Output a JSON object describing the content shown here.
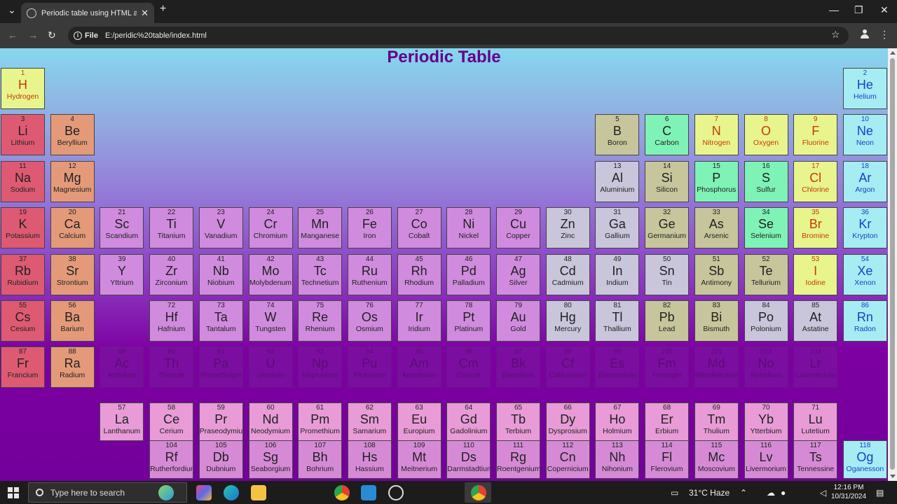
{
  "browser": {
    "tab_title": "Periodic table using HTML and",
    "tab_close": "✕",
    "new_tab": "+",
    "address_chip": "File",
    "url": "E:/peridic%20table/index.html"
  },
  "page": {
    "title": "Periodic Table"
  },
  "colors": {
    "alkali": "#de5a73",
    "alkaline": "#e49a79",
    "transition": "#d08bde",
    "post_transition": "#c9c5db",
    "metalloid": "#c7c59b",
    "nonmetal": "#7ff2b6",
    "noble": "#a6ecf3",
    "halogen": "#e8f58c",
    "lanthanide": "#e89bd7",
    "actinide": "#d68ad6",
    "period7_faded": "#7a2aa0"
  },
  "elements": [
    {
      "n": "1",
      "s": "H",
      "name": "Hydrogen",
      "cat": "halogen",
      "col": 1,
      "row": 1
    },
    {
      "n": "2",
      "s": "He",
      "name": "Helium",
      "cat": "noble",
      "col": 18,
      "row": 1
    },
    {
      "n": "3",
      "s": "Li",
      "name": "Lithium",
      "cat": "alkali",
      "col": 1,
      "row": 2
    },
    {
      "n": "4",
      "s": "Be",
      "name": "Beryllium",
      "cat": "alkaline",
      "col": 2,
      "row": 2
    },
    {
      "n": "5",
      "s": "B",
      "name": "Boron",
      "cat": "metalloid",
      "col": 13,
      "row": 2
    },
    {
      "n": "6",
      "s": "C",
      "name": "Carbon",
      "cat": "nonmetal",
      "col": 14,
      "row": 2
    },
    {
      "n": "7",
      "s": "N",
      "name": "Nitrogen",
      "cat": "halogen",
      "col": 15,
      "row": 2
    },
    {
      "n": "8",
      "s": "O",
      "name": "Oxygen",
      "cat": "halogen",
      "col": 16,
      "row": 2
    },
    {
      "n": "9",
      "s": "F",
      "name": "Fluorine",
      "cat": "halogen",
      "col": 17,
      "row": 2
    },
    {
      "n": "10",
      "s": "Ne",
      "name": "Neon",
      "cat": "noble",
      "col": 18,
      "row": 2
    },
    {
      "n": "11",
      "s": "Na",
      "name": "Sodium",
      "cat": "alkali",
      "col": 1,
      "row": 3
    },
    {
      "n": "12",
      "s": "Mg",
      "name": "Magnesium",
      "cat": "alkaline",
      "col": 2,
      "row": 3
    },
    {
      "n": "13",
      "s": "Al",
      "name": "Aluminium",
      "cat": "post_transition",
      "col": 13,
      "row": 3
    },
    {
      "n": "14",
      "s": "Si",
      "name": "Silicon",
      "cat": "metalloid",
      "col": 14,
      "row": 3
    },
    {
      "n": "15",
      "s": "P",
      "name": "Phosphorus",
      "cat": "nonmetal",
      "col": 15,
      "row": 3
    },
    {
      "n": "16",
      "s": "S",
      "name": "Sulfur",
      "cat": "nonmetal",
      "col": 16,
      "row": 3
    },
    {
      "n": "17",
      "s": "Cl",
      "name": "Chlorine",
      "cat": "halogen",
      "col": 17,
      "row": 3
    },
    {
      "n": "18",
      "s": "Ar",
      "name": "Argon",
      "cat": "noble",
      "col": 18,
      "row": 3
    },
    {
      "n": "19",
      "s": "K",
      "name": "Potassium",
      "cat": "alkali",
      "col": 1,
      "row": 4
    },
    {
      "n": "20",
      "s": "Ca",
      "name": "Calcium",
      "cat": "alkaline",
      "col": 2,
      "row": 4
    },
    {
      "n": "21",
      "s": "Sc",
      "name": "Scandium",
      "cat": "transition",
      "col": 3,
      "row": 4
    },
    {
      "n": "22",
      "s": "Ti",
      "name": "Titanium",
      "cat": "transition",
      "col": 4,
      "row": 4
    },
    {
      "n": "23",
      "s": "V",
      "name": "Vanadium",
      "cat": "transition",
      "col": 5,
      "row": 4
    },
    {
      "n": "24",
      "s": "Cr",
      "name": "Chromium",
      "cat": "transition",
      "col": 6,
      "row": 4
    },
    {
      "n": "25",
      "s": "Mn",
      "name": "Manganese",
      "cat": "transition",
      "col": 7,
      "row": 4
    },
    {
      "n": "26",
      "s": "Fe",
      "name": "Iron",
      "cat": "transition",
      "col": 8,
      "row": 4
    },
    {
      "n": "27",
      "s": "Co",
      "name": "Cobalt",
      "cat": "transition",
      "col": 9,
      "row": 4
    },
    {
      "n": "28",
      "s": "Ni",
      "name": "Nickel",
      "cat": "transition",
      "col": 10,
      "row": 4
    },
    {
      "n": "29",
      "s": "Cu",
      "name": "Copper",
      "cat": "transition",
      "col": 11,
      "row": 4
    },
    {
      "n": "30",
      "s": "Zn",
      "name": "Zinc",
      "cat": "post_transition",
      "col": 12,
      "row": 4
    },
    {
      "n": "31",
      "s": "Ga",
      "name": "Gallium",
      "cat": "post_transition",
      "col": 13,
      "row": 4
    },
    {
      "n": "32",
      "s": "Ge",
      "name": "Germanium",
      "cat": "metalloid",
      "col": 14,
      "row": 4
    },
    {
      "n": "33",
      "s": "As",
      "name": "Arsenic",
      "cat": "metalloid",
      "col": 15,
      "row": 4
    },
    {
      "n": "34",
      "s": "Se",
      "name": "Selenium",
      "cat": "nonmetal",
      "col": 16,
      "row": 4
    },
    {
      "n": "35",
      "s": "Br",
      "name": "Bromine",
      "cat": "halogen",
      "col": 17,
      "row": 4
    },
    {
      "n": "36",
      "s": "Kr",
      "name": "Krypton",
      "cat": "noble",
      "col": 18,
      "row": 4
    },
    {
      "n": "37",
      "s": "Rb",
      "name": "Rubidium",
      "cat": "alkali",
      "col": 1,
      "row": 5
    },
    {
      "n": "38",
      "s": "Sr",
      "name": "Strontium",
      "cat": "alkaline",
      "col": 2,
      "row": 5
    },
    {
      "n": "39",
      "s": "Y",
      "name": "Yttrium",
      "cat": "transition",
      "col": 3,
      "row": 5
    },
    {
      "n": "40",
      "s": "Zr",
      "name": "Zirconium",
      "cat": "transition",
      "col": 4,
      "row": 5
    },
    {
      "n": "41",
      "s": "Nb",
      "name": "Niobium",
      "cat": "transition",
      "col": 5,
      "row": 5
    },
    {
      "n": "42",
      "s": "Mo",
      "name": "Molybdenum",
      "cat": "transition",
      "col": 6,
      "row": 5
    },
    {
      "n": "43",
      "s": "Tc",
      "name": "Technetium",
      "cat": "transition",
      "col": 7,
      "row": 5
    },
    {
      "n": "44",
      "s": "Ru",
      "name": "Ruthenium",
      "cat": "transition",
      "col": 8,
      "row": 5
    },
    {
      "n": "45",
      "s": "Rh",
      "name": "Rhodium",
      "cat": "transition",
      "col": 9,
      "row": 5
    },
    {
      "n": "46",
      "s": "Pd",
      "name": "Palladium",
      "cat": "transition",
      "col": 10,
      "row": 5
    },
    {
      "n": "47",
      "s": "Ag",
      "name": "Silver",
      "cat": "transition",
      "col": 11,
      "row": 5
    },
    {
      "n": "48",
      "s": "Cd",
      "name": "Cadmium",
      "cat": "post_transition",
      "col": 12,
      "row": 5
    },
    {
      "n": "49",
      "s": "In",
      "name": "Indium",
      "cat": "post_transition",
      "col": 13,
      "row": 5
    },
    {
      "n": "50",
      "s": "Sn",
      "name": "Tin",
      "cat": "post_transition",
      "col": 14,
      "row": 5
    },
    {
      "n": "51",
      "s": "Sb",
      "name": "Antimony",
      "cat": "metalloid",
      "col": 15,
      "row": 5
    },
    {
      "n": "52",
      "s": "Te",
      "name": "Tellurium",
      "cat": "metalloid",
      "col": 16,
      "row": 5
    },
    {
      "n": "53",
      "s": "I",
      "name": "Iodine",
      "cat": "halogen",
      "col": 17,
      "row": 5
    },
    {
      "n": "54",
      "s": "Xe",
      "name": "Xenon",
      "cat": "noble",
      "col": 18,
      "row": 5
    },
    {
      "n": "55",
      "s": "Cs",
      "name": "Cesium",
      "cat": "alkali",
      "col": 1,
      "row": 6
    },
    {
      "n": "56",
      "s": "Ba",
      "name": "Barium",
      "cat": "alkaline",
      "col": 2,
      "row": 6
    },
    {
      "n": "72",
      "s": "Hf",
      "name": "Hafnium",
      "cat": "transition",
      "col": 4,
      "row": 6
    },
    {
      "n": "73",
      "s": "Ta",
      "name": "Tantalum",
      "cat": "transition",
      "col": 5,
      "row": 6
    },
    {
      "n": "74",
      "s": "W",
      "name": "Tungsten",
      "cat": "transition",
      "col": 6,
      "row": 6
    },
    {
      "n": "75",
      "s": "Re",
      "name": "Rhenium",
      "cat": "transition",
      "col": 7,
      "row": 6
    },
    {
      "n": "76",
      "s": "Os",
      "name": "Osmium",
      "cat": "transition",
      "col": 8,
      "row": 6
    },
    {
      "n": "77",
      "s": "Ir",
      "name": "Iridium",
      "cat": "transition",
      "col": 9,
      "row": 6
    },
    {
      "n": "78",
      "s": "Pt",
      "name": "Platinum",
      "cat": "transition",
      "col": 10,
      "row": 6
    },
    {
      "n": "79",
      "s": "Au",
      "name": "Gold",
      "cat": "transition",
      "col": 11,
      "row": 6
    },
    {
      "n": "80",
      "s": "Hg",
      "name": "Mercury",
      "cat": "post_transition",
      "col": 12,
      "row": 6
    },
    {
      "n": "81",
      "s": "Tl",
      "name": "Thallium",
      "cat": "post_transition",
      "col": 13,
      "row": 6
    },
    {
      "n": "82",
      "s": "Pb",
      "name": "Lead",
      "cat": "metalloid",
      "col": 14,
      "row": 6
    },
    {
      "n": "83",
      "s": "Bi",
      "name": "Bismuth",
      "cat": "metalloid",
      "col": 15,
      "row": 6
    },
    {
      "n": "84",
      "s": "Po",
      "name": "Polonium",
      "cat": "post_transition",
      "col": 16,
      "row": 6
    },
    {
      "n": "85",
      "s": "At",
      "name": "Astatine",
      "cat": "post_transition",
      "col": 17,
      "row": 6
    },
    {
      "n": "86",
      "s": "Rn",
      "name": "Radon",
      "cat": "noble",
      "col": 18,
      "row": 6
    },
    {
      "n": "87",
      "s": "Fr",
      "name": "Francium",
      "cat": "alkali",
      "col": 1,
      "row": 7
    },
    {
      "n": "88",
      "s": "Ra",
      "name": "Radium",
      "cat": "alkaline",
      "col": 2,
      "row": 7
    },
    {
      "n": "89",
      "s": "Ac",
      "name": "Actinium",
      "cat": "period7_faded",
      "col": 3,
      "row": 7,
      "faded": true
    },
    {
      "n": "90",
      "s": "Th",
      "name": "Thorium",
      "cat": "period7_faded",
      "col": 4,
      "row": 7,
      "faded": true
    },
    {
      "n": "91",
      "s": "Pa",
      "name": "Protactinium",
      "cat": "period7_faded",
      "col": 5,
      "row": 7,
      "faded": true
    },
    {
      "n": "92",
      "s": "U",
      "name": "Uranium",
      "cat": "period7_faded",
      "col": 6,
      "row": 7,
      "faded": true
    },
    {
      "n": "93",
      "s": "Np",
      "name": "Neptunium",
      "cat": "period7_faded",
      "col": 7,
      "row": 7,
      "faded": true
    },
    {
      "n": "94",
      "s": "Pu",
      "name": "Plutonium",
      "cat": "period7_faded",
      "col": 8,
      "row": 7,
      "faded": true
    },
    {
      "n": "95",
      "s": "Am",
      "name": "Americium",
      "cat": "period7_faded",
      "col": 9,
      "row": 7,
      "faded": true
    },
    {
      "n": "96",
      "s": "Cm",
      "name": "Curium",
      "cat": "period7_faded",
      "col": 10,
      "row": 7,
      "faded": true
    },
    {
      "n": "97",
      "s": "Bk",
      "name": "Berkelium",
      "cat": "period7_faded",
      "col": 11,
      "row": 7,
      "faded": true
    },
    {
      "n": "98",
      "s": "Cf",
      "name": "Californium",
      "cat": "period7_faded",
      "col": 12,
      "row": 7,
      "faded": true
    },
    {
      "n": "99",
      "s": "Es",
      "name": "Einsteinium",
      "cat": "period7_faded",
      "col": 13,
      "row": 7,
      "faded": true
    },
    {
      "n": "100",
      "s": "Fm",
      "name": "Fermium",
      "cat": "period7_faded",
      "col": 14,
      "row": 7,
      "faded": true
    },
    {
      "n": "101",
      "s": "Md",
      "name": "Mendelevium",
      "cat": "period7_faded",
      "col": 15,
      "row": 7,
      "faded": true
    },
    {
      "n": "102",
      "s": "No",
      "name": "Nobelium",
      "cat": "period7_faded",
      "col": 16,
      "row": 7,
      "faded": true
    },
    {
      "n": "103",
      "s": "Lr",
      "name": "Lawrencium",
      "cat": "period7_faded",
      "col": 17,
      "row": 7,
      "faded": true
    },
    {
      "n": "57",
      "s": "La",
      "name": "Lanthanum",
      "cat": "lanthanide",
      "col": 3,
      "row": 8
    },
    {
      "n": "58",
      "s": "Ce",
      "name": "Cerium",
      "cat": "lanthanide",
      "col": 4,
      "row": 8
    },
    {
      "n": "59",
      "s": "Pr",
      "name": "Praseodymium",
      "cat": "lanthanide",
      "col": 5,
      "row": 8
    },
    {
      "n": "60",
      "s": "Nd",
      "name": "Neodymium",
      "cat": "lanthanide",
      "col": 6,
      "row": 8
    },
    {
      "n": "61",
      "s": "Pm",
      "name": "Promethium",
      "cat": "lanthanide",
      "col": 7,
      "row": 8
    },
    {
      "n": "62",
      "s": "Sm",
      "name": "Samarium",
      "cat": "lanthanide",
      "col": 8,
      "row": 8
    },
    {
      "n": "63",
      "s": "Eu",
      "name": "Europium",
      "cat": "lanthanide",
      "col": 9,
      "row": 8
    },
    {
      "n": "64",
      "s": "Gd",
      "name": "Gadolinium",
      "cat": "lanthanide",
      "col": 10,
      "row": 8
    },
    {
      "n": "65",
      "s": "Tb",
      "name": "Terbium",
      "cat": "lanthanide",
      "col": 11,
      "row": 8
    },
    {
      "n": "66",
      "s": "Dy",
      "name": "Dysprosium",
      "cat": "lanthanide",
      "col": 12,
      "row": 8
    },
    {
      "n": "67",
      "s": "Ho",
      "name": "Holmium",
      "cat": "lanthanide",
      "col": 13,
      "row": 8
    },
    {
      "n": "68",
      "s": "Er",
      "name": "Erbium",
      "cat": "lanthanide",
      "col": 14,
      "row": 8
    },
    {
      "n": "69",
      "s": "Tm",
      "name": "Thulium",
      "cat": "lanthanide",
      "col": 15,
      "row": 8
    },
    {
      "n": "70",
      "s": "Yb",
      "name": "Ytterbium",
      "cat": "lanthanide",
      "col": 16,
      "row": 8
    },
    {
      "n": "71",
      "s": "Lu",
      "name": "Lutetium",
      "cat": "lanthanide",
      "col": 17,
      "row": 8
    },
    {
      "n": "104",
      "s": "Rf",
      "name": "Rutherfordium",
      "cat": "actinide",
      "col": 4,
      "row": 9
    },
    {
      "n": "105",
      "s": "Db",
      "name": "Dubnium",
      "cat": "actinide",
      "col": 5,
      "row": 9
    },
    {
      "n": "106",
      "s": "Sg",
      "name": "Seaborgium",
      "cat": "actinide",
      "col": 6,
      "row": 9
    },
    {
      "n": "107",
      "s": "Bh",
      "name": "Bohrium",
      "cat": "actinide",
      "col": 7,
      "row": 9
    },
    {
      "n": "108",
      "s": "Hs",
      "name": "Hassium",
      "cat": "actinide",
      "col": 8,
      "row": 9
    },
    {
      "n": "109",
      "s": "Mt",
      "name": "Meitnerium",
      "cat": "actinide",
      "col": 9,
      "row": 9
    },
    {
      "n": "110",
      "s": "Ds",
      "name": "Darmstadtium",
      "cat": "actinide",
      "col": 10,
      "row": 9
    },
    {
      "n": "111",
      "s": "Rg",
      "name": "Roentgenium",
      "cat": "actinide",
      "col": 11,
      "row": 9
    },
    {
      "n": "112",
      "s": "Cn",
      "name": "Copernicium",
      "cat": "actinide",
      "col": 12,
      "row": 9
    },
    {
      "n": "113",
      "s": "Nh",
      "name": "Nihonium",
      "cat": "actinide",
      "col": 13,
      "row": 9
    },
    {
      "n": "114",
      "s": "Fl",
      "name": "Flerovium",
      "cat": "actinide",
      "col": 14,
      "row": 9
    },
    {
      "n": "115",
      "s": "Mc",
      "name": "Moscovium",
      "cat": "actinide",
      "col": 15,
      "row": 9
    },
    {
      "n": "116",
      "s": "Lv",
      "name": "Livermorium",
      "cat": "actinide",
      "col": 16,
      "row": 9
    },
    {
      "n": "117",
      "s": "Ts",
      "name": "Tennessine",
      "cat": "actinide",
      "col": 17,
      "row": 9
    },
    {
      "n": "118",
      "s": "Og",
      "name": "Oganesson",
      "cat": "noble",
      "col": 18,
      "row": 9
    }
  ],
  "taskbar": {
    "search_placeholder": "Type here to search",
    "weather": "31°C  Haze",
    "time": "12:16 PM",
    "date": "10/31/2024"
  }
}
